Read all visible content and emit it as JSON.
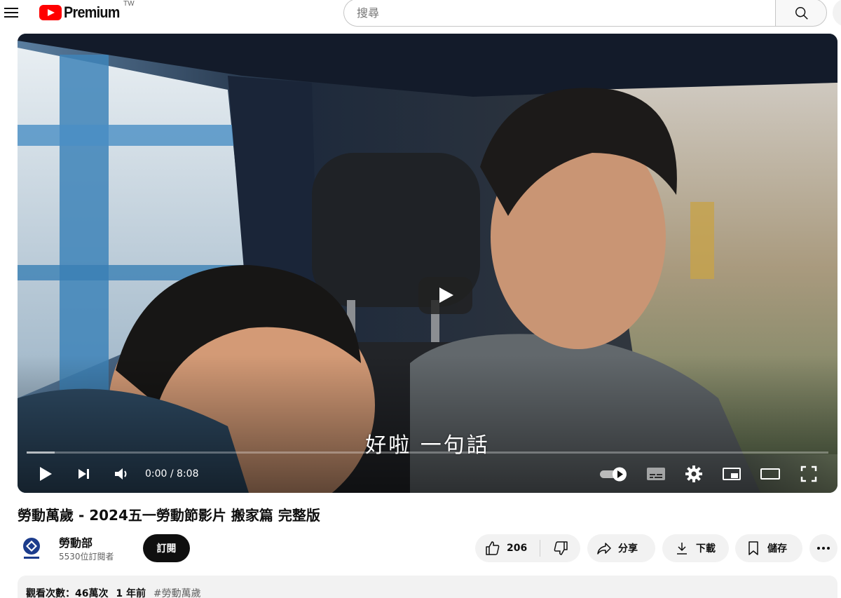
{
  "header": {
    "logo_text": "Premium",
    "region": "TW",
    "search_placeholder": "搜尋"
  },
  "player": {
    "subtitle": "好啦 一句話",
    "time": "0:00 / 8:08",
    "progress_loaded_fraction": 0.035
  },
  "video": {
    "title": "勞動萬歲 - 2024五一勞動節影片 搬家篇 完整版"
  },
  "channel": {
    "name": "勞動部",
    "subscribers": "5530位訂閱者",
    "subscribe_label": "訂閱"
  },
  "actions": {
    "like_count": "206",
    "share_label": "分享",
    "download_label": "下載",
    "save_label": "儲存"
  },
  "description": {
    "views": "觀看次數：46萬次",
    "age": "1 年前",
    "hashtag": "#勞動萬歲"
  },
  "colors": {
    "brand_red": "#ff0000",
    "chip_bg": "#f2f2f2",
    "subscribe_bg": "#0f0f0f"
  },
  "icons": [
    "menu-icon",
    "youtube-logo-icon",
    "search-icon",
    "play-icon",
    "next-icon",
    "volume-icon",
    "autoplay-toggle-icon",
    "subtitles-icon",
    "settings-icon",
    "miniplayer-icon",
    "theater-icon",
    "fullscreen-icon",
    "thumbs-up-icon",
    "thumbs-down-icon",
    "share-icon",
    "download-icon",
    "bookmark-icon",
    "more-icon"
  ]
}
